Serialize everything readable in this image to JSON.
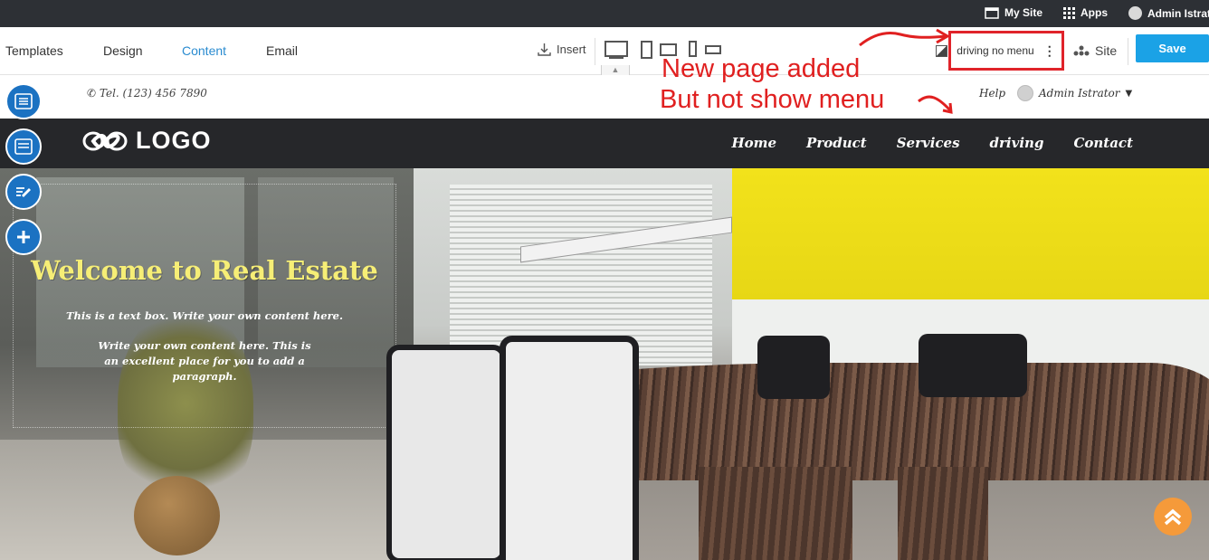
{
  "admin_bar": {
    "my_site": "My Site",
    "apps": "Apps",
    "user": "Admin Istrator"
  },
  "toolbar": {
    "tabs": [
      "Templates",
      "Design",
      "Content",
      "Email"
    ],
    "active_tab": "Content",
    "insert": "Insert",
    "page_name": "driving no menu",
    "site": "Site",
    "save": "Save"
  },
  "site_header": {
    "phone": "Tel. (123) 456 7890",
    "help": "Help",
    "user": "Admin Istrator"
  },
  "navbar": {
    "logo": "LOGO",
    "menu": [
      "Home",
      "Product",
      "Services",
      "driving",
      "Contact"
    ]
  },
  "hero": {
    "title": "Welcome to Real Estate",
    "paragraph1": "This is a text box. Write your own content here.",
    "paragraph2": "Write your own content here. This is an excellent place for you to add a paragraph."
  },
  "annotation": {
    "line1": "New page added",
    "line2": "But not show menu"
  },
  "colors": {
    "accent_blue": "#1ba2e6",
    "active_tab": "#2a8bd0",
    "annotation_red": "#e02020",
    "hero_title": "#f6ee76",
    "scroll_top": "#f59a3a",
    "navbar_bg": "#26272a"
  }
}
